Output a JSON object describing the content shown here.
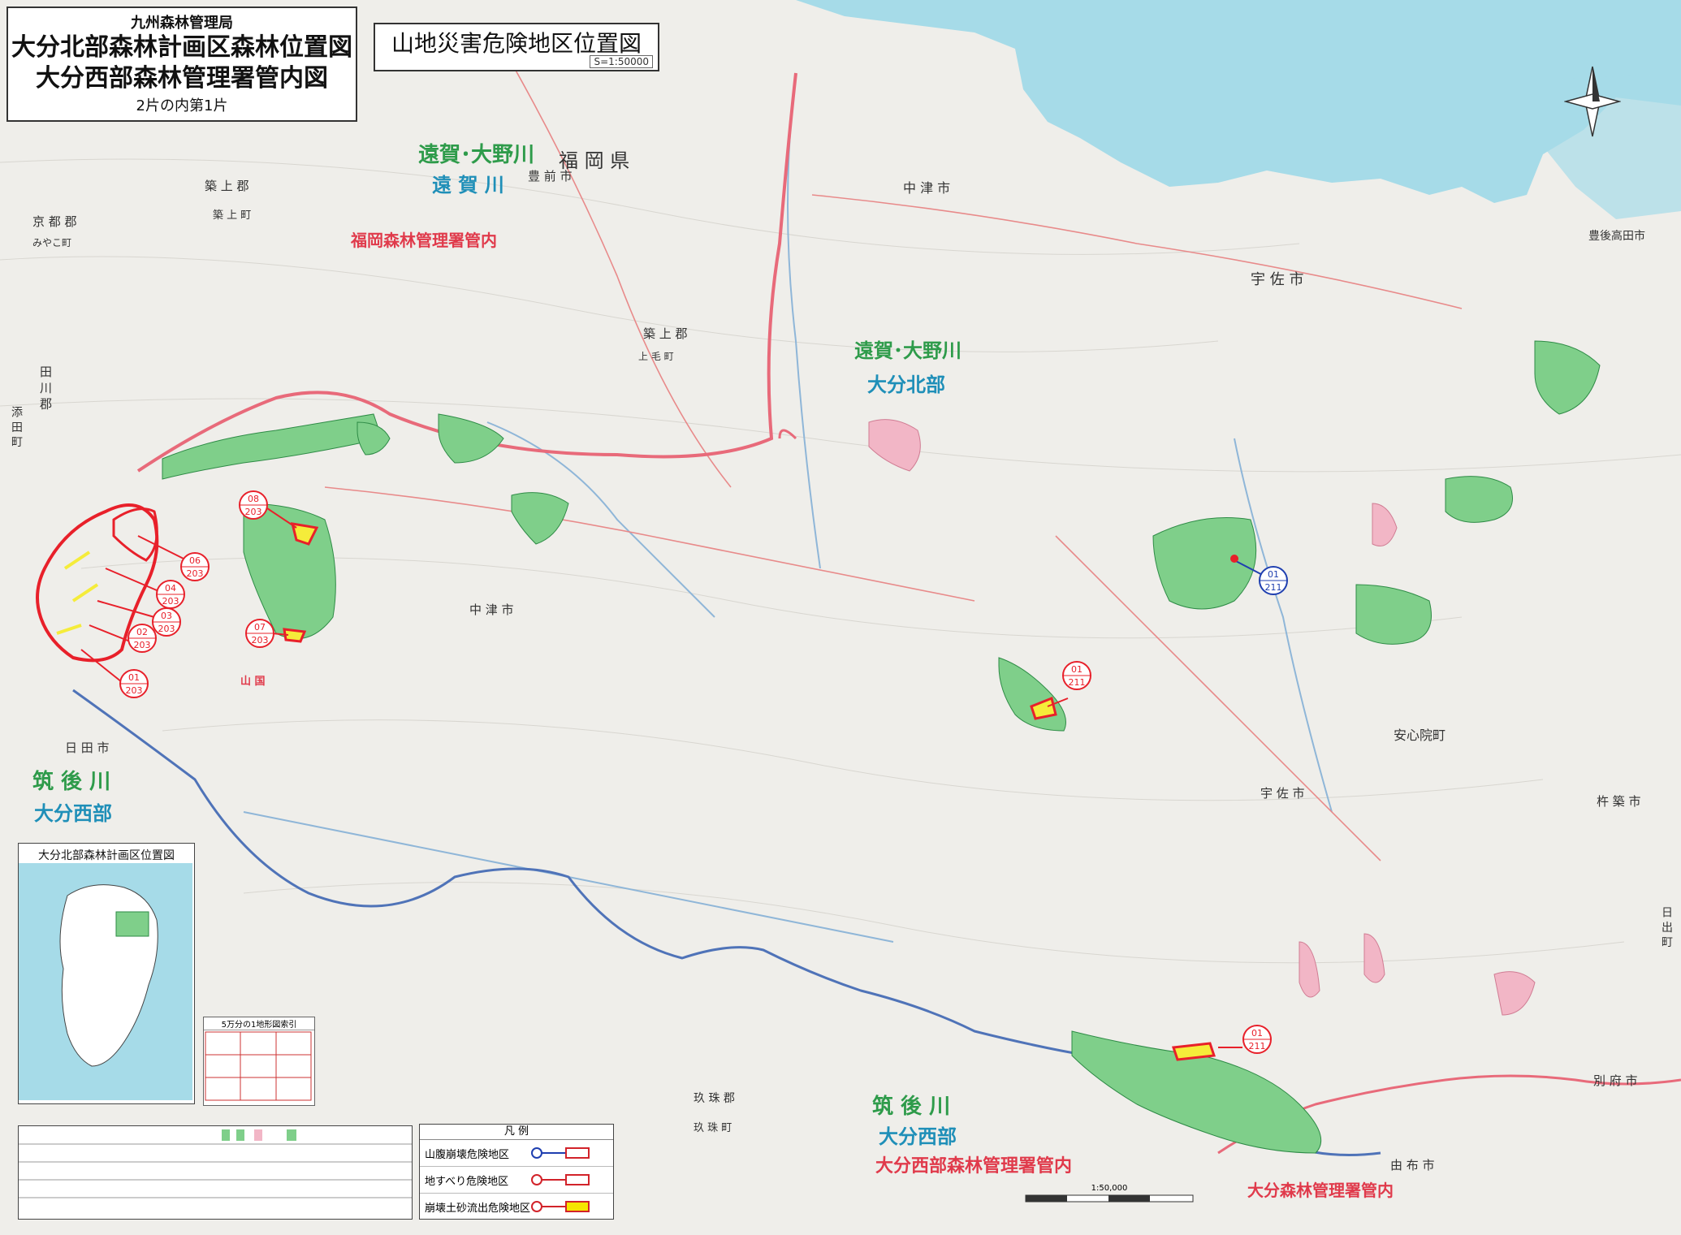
{
  "title": {
    "office": "九州森林管理局",
    "line1": "大分北部森林計画区森林位置図",
    "line2": "大分西部森林管理署管内図",
    "sheet": "2片の内第1片"
  },
  "map_heading": "山地災害危険地区位置図",
  "scale_label": "S=1:50000",
  "region_labels": {
    "onga_ono_top": "遠賀･大野川",
    "onga_gawa": "遠 賀 川",
    "fukuoka_ken": "福 岡 県",
    "fukuoka_office": "福岡森林管理署管内",
    "onga_ono_mid": "遠賀･大野川",
    "oita_hokubu": "大分北部",
    "chikugo_left": "筑 後 川",
    "oita_seibu_left": "大分西部",
    "chikugo_bottom": "筑 後 川",
    "oita_seibu_bottom": "大分西部",
    "oita_seibu_office": "大分西部森林管理署管内",
    "oita_office": "大分森林管理署管内"
  },
  "place_labels": {
    "nakatsu_shi_top": "中 津 市",
    "usa_shi_top": "宇 佐 市",
    "buzen_shi": "豊 前 市",
    "chikujo_gun_top": "築 上 郡",
    "chikujo_cho": "築 上 町",
    "miyako_gun": "京 都 郡",
    "miyako_machi": "みやこ町",
    "chikujo_gun_mid": "築 上 郡",
    "kouge_machi": "上 毛 町",
    "tagawa_gun": "田 川 郡",
    "soeda_machi": "添 田 町",
    "bungo_takada": "豊後高田市",
    "nakatsu_shi_mid": "中 津 市",
    "yamakuni": "山 国",
    "hita_shi": "日 田 市",
    "ajimu_machi": "安心院町",
    "usa_shi_mid": "宇 佐 市",
    "kitsuki_shi": "杵 築 市",
    "hiji_machi": "日 出 町",
    "beppu_shi": "別 府 市",
    "yufu_shi": "由 布 市",
    "kusu_gun": "玖 珠 郡",
    "kusu_machi": "玖 珠 町"
  },
  "hazard_labels": [
    {
      "id": "06",
      "no": "203"
    },
    {
      "id": "04",
      "no": "203"
    },
    {
      "id": "03",
      "no": "203"
    },
    {
      "id": "02",
      "no": "203"
    },
    {
      "id": "01",
      "no": "203"
    },
    {
      "id": "08",
      "no": "203"
    },
    {
      "id": "07",
      "no": "203"
    },
    {
      "id": "01",
      "no": "211"
    },
    {
      "id": "01",
      "no": "211"
    },
    {
      "id": "01",
      "no": "211"
    }
  ],
  "inset": {
    "title": "大分北部森林計画区位置図"
  },
  "index_table_title": "5万分の1地形図索引",
  "legend": {
    "heading": "凡 例",
    "rows": [
      {
        "label": "山腹崩壊危険地区",
        "color": "#1f3fb0"
      },
      {
        "label": "地すべり危険地区",
        "color": "#d2232a"
      },
      {
        "label": "崩壊土砂流出危険地区",
        "color": "#d2232a",
        "fill": "#f5e600"
      }
    ]
  },
  "scale_bar_label": "1:50,000",
  "colors": {
    "sea": "#a6dbe8",
    "forest": "#7fcf8a",
    "hazard_red": "#e8202a",
    "hazard_yellow": "#f5ec3a",
    "prefecture_border": "#e86a7a"
  }
}
